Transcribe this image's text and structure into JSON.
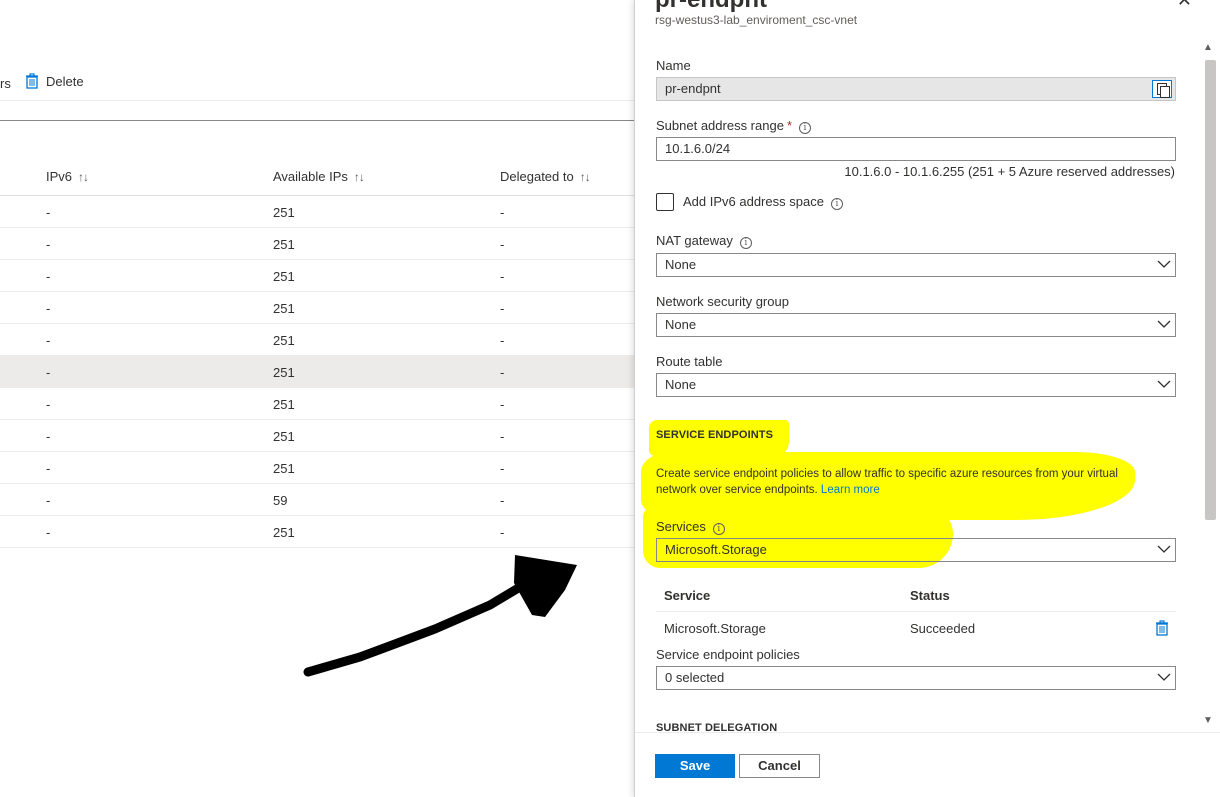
{
  "toolbar": {
    "partial_label": "rs",
    "delete_label": "Delete"
  },
  "table": {
    "headers": [
      "IPv6",
      "Available IPs",
      "Delegated to"
    ],
    "rows": [
      {
        "ipv6": "-",
        "available": "251",
        "delegated": "-"
      },
      {
        "ipv6": "-",
        "available": "251",
        "delegated": "-"
      },
      {
        "ipv6": "-",
        "available": "251",
        "delegated": "-"
      },
      {
        "ipv6": "-",
        "available": "251",
        "delegated": "-"
      },
      {
        "ipv6": "-",
        "available": "251",
        "delegated": "-"
      },
      {
        "ipv6": "-",
        "available": "251",
        "delegated": "-"
      },
      {
        "ipv6": "-",
        "available": "251",
        "delegated": "-"
      },
      {
        "ipv6": "-",
        "available": "251",
        "delegated": "-"
      },
      {
        "ipv6": "-",
        "available": "251",
        "delegated": "-"
      },
      {
        "ipv6": "-",
        "available": "59",
        "delegated": "-"
      },
      {
        "ipv6": "-",
        "available": "251",
        "delegated": "-"
      }
    ]
  },
  "blade": {
    "title": "pr-endpnt",
    "subtitle": "rsg-westus3-lab_enviroment_csc-vnet",
    "name_label": "Name",
    "name_value": "pr-endpnt",
    "subnet_label": "Subnet address range",
    "subnet_value": "10.1.6.0/24",
    "subnet_hint": "10.1.6.0 - 10.1.6.255 (251 + 5 Azure reserved addresses)",
    "ipv6_label": "Add IPv6 address space",
    "nat_label": "NAT gateway",
    "nat_value": "None",
    "nsg_label": "Network security group",
    "nsg_value": "None",
    "route_label": "Route table",
    "route_value": "None",
    "service_endpoints_heading": "SERVICE ENDPOINTS",
    "service_endpoints_desc": "Create service endpoint policies to allow traffic to specific azure resources from your virtual network over service endpoints.",
    "learn_more": "Learn more",
    "services_label": "Services",
    "services_value": "Microsoft.Storage",
    "svc_table": {
      "headers": [
        "Service",
        "Status"
      ],
      "rows": [
        {
          "service": "Microsoft.Storage",
          "status": "Succeeded"
        }
      ]
    },
    "policies_label": "Service endpoint policies",
    "policies_value": "0 selected",
    "subnet_delegation_heading": "SUBNET DELEGATION",
    "save_label": "Save",
    "cancel_label": "Cancel"
  },
  "colors": {
    "accent": "#0078d4",
    "highlight": "#ffff00",
    "required": "#a4262c"
  }
}
